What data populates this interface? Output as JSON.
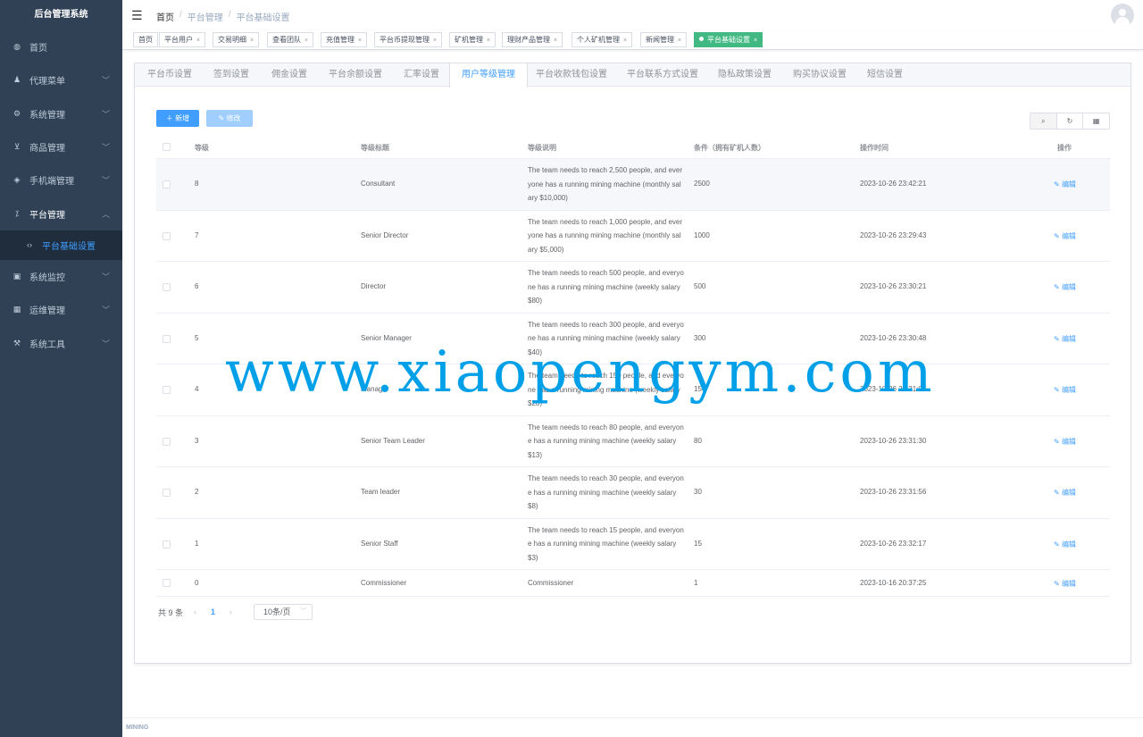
{
  "app": {
    "title": "后台管理系统"
  },
  "sidebar": {
    "items": [
      {
        "label": "首页",
        "icon": "◍"
      },
      {
        "label": "代理菜单",
        "icon": "♟"
      },
      {
        "label": "系统管理",
        "icon": "⚙"
      },
      {
        "label": "商品管理",
        "icon": "⊻"
      },
      {
        "label": "手机端管理",
        "icon": "◈"
      },
      {
        "label": "平台管理",
        "icon": "⁒"
      },
      {
        "label": "平台基础设置",
        "icon": "‹›"
      },
      {
        "label": "系统监控",
        "icon": "▣"
      },
      {
        "label": "运维管理",
        "icon": "▦"
      },
      {
        "label": "系统工具",
        "icon": "⚒"
      }
    ]
  },
  "breadcrumb": {
    "items": [
      "首页",
      "平台管理",
      "平台基础设置"
    ]
  },
  "tags": [
    {
      "label": "首页"
    },
    {
      "label": "平台用户"
    },
    {
      "label": "交易明细"
    },
    {
      "label": "查看团队"
    },
    {
      "label": "充值管理"
    },
    {
      "label": "平台币提现管理"
    },
    {
      "label": "矿机管理"
    },
    {
      "label": "理财产品管理"
    },
    {
      "label": "个人矿机管理"
    },
    {
      "label": "新闻管理"
    },
    {
      "label": "平台基础设置"
    }
  ],
  "tabs": [
    "平台币设置",
    "签到设置",
    "佣金设置",
    "平台余额设置",
    "汇率设置",
    "用户等级管理",
    "平台收款钱包设置",
    "平台联系方式设置",
    "隐私政策设置",
    "购买协议设置",
    "短信设置"
  ],
  "toolbar": {
    "add_label": "新增",
    "edit_label": "修改"
  },
  "table": {
    "headers": {
      "level": "等级",
      "title": "等级标题",
      "desc": "等级说明",
      "cond": "条件（拥有矿机人数）",
      "time": "操作时间",
      "op": "操作"
    },
    "op_label": "编辑",
    "rows": [
      {
        "level": "8",
        "title": "Consultant",
        "desc": "The team needs to reach 2,500 people, and everyone has a running mining machine (monthly salary $10,000)",
        "cond": "2500",
        "time": "2023-10-26 23:42:21"
      },
      {
        "level": "7",
        "title": "Senior Director",
        "desc": "The team needs to reach 1,000 people, and everyone has a running mining machine (monthly salary $5,000)",
        "cond": "1000",
        "time": "2023-10-26 23:29:43"
      },
      {
        "level": "6",
        "title": "Director",
        "desc": "The team needs to reach 500 people, and everyone has a running mining machine (weekly salary $80)",
        "cond": "500",
        "time": "2023-10-26 23:30:21"
      },
      {
        "level": "5",
        "title": "Senior Manager",
        "desc": "The team needs to reach 300 people, and everyone has a running mining machine (weekly salary $40)",
        "cond": "300",
        "time": "2023-10-26 23:30:48"
      },
      {
        "level": "4",
        "title": "Manager",
        "desc": "The team needs to reach 150 people, and everyone has a running mining machine (weekly salary $20)",
        "cond": "150",
        "time": "2023-10-26 23:31:07"
      },
      {
        "level": "3",
        "title": "Senior Team Leader",
        "desc": "The team needs to reach 80 people, and everyone has a running mining machine (weekly salary $13)",
        "cond": "80",
        "time": "2023-10-26 23:31:30"
      },
      {
        "level": "2",
        "title": "Team leader",
        "desc": "The team needs to reach 30 people, and everyone has a running mining machine (weekly salary $8)",
        "cond": "30",
        "time": "2023-10-26 23:31:56"
      },
      {
        "level": "1",
        "title": "Senior Staff",
        "desc": "The team needs to reach 15 people, and everyone has a running mining machine (weekly salary $3)",
        "cond": "15",
        "time": "2023-10-26 23:32:17"
      },
      {
        "level": "0",
        "title": "Commissioner",
        "desc": "Commissioner",
        "cond": "1",
        "time": "2023-10-16 20:37:25"
      }
    ]
  },
  "pagination": {
    "total": "共 9 条",
    "page": "1",
    "size": "10条/页"
  },
  "footer": {
    "text": "MINING"
  },
  "watermark": "www.xiaopengym.com",
  "colors": {
    "sidebar_bg": "#304156",
    "primary": "#409eff",
    "tag_active": "#42b983"
  }
}
